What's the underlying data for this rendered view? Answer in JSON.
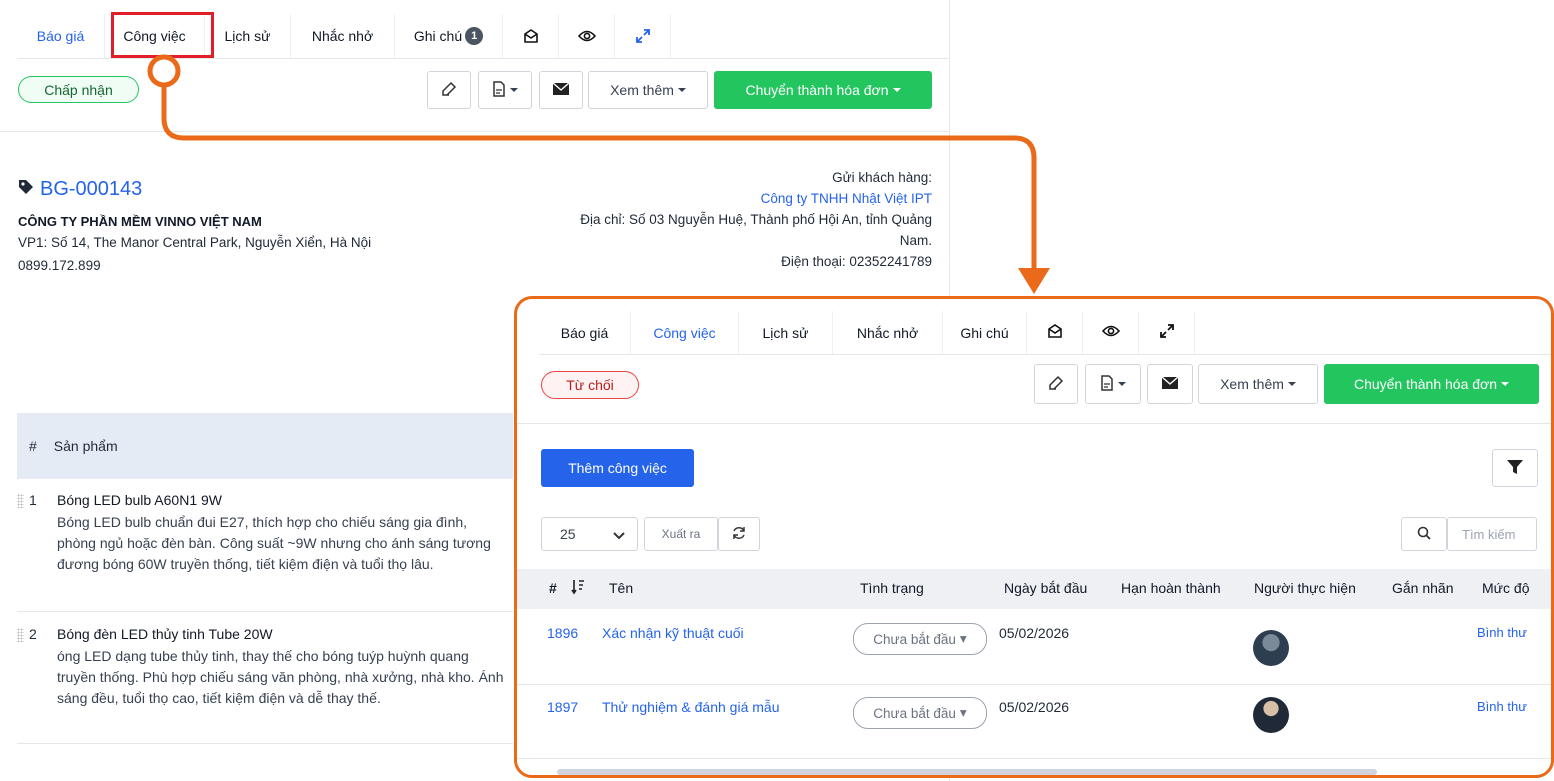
{
  "main": {
    "tabs": [
      {
        "label": "Báo giá",
        "state": "link"
      },
      {
        "label": "Công việc",
        "state": "highlighted"
      },
      {
        "label": "Lịch sử"
      },
      {
        "label": "Nhắc nhở"
      },
      {
        "label": "Ghi chú",
        "badge": "1"
      }
    ],
    "status_pill": "Chấp nhận",
    "toolbar": {
      "more_label": "Xem thêm",
      "convert_label": "Chuyển thành hóa đơn"
    },
    "quote_id": "BG-000143",
    "company_name": "CÔNG TY PHẦN MỀM VINNO VIỆT NAM",
    "company_address": "VP1: Số 14, The Manor Central Park, Nguyễn Xiển, Hà Nội",
    "company_phone": "0899.172.899",
    "send_to_label": "Gửi khách hàng:",
    "customer_name": "Công ty TNHH Nhật Việt IPT",
    "customer_address_1": "Địa chỉ: Số 03 Nguyễn Huệ, Thành phố Hội An, tỉnh Quảng",
    "customer_address_2": "Nam.",
    "customer_phone": "Điện thoại: 02352241789",
    "products_header": {
      "hash": "#",
      "product": "Sản phẩm"
    },
    "products": [
      {
        "num": "1",
        "title": "Bóng LED bulb A60N1 9W",
        "desc": "Bóng LED bulb chuẩn đui E27, thích hợp cho chiếu sáng gia đình, phòng ngủ hoặc đèn bàn. Công suất ~9W nhưng cho ánh sáng tương đương bóng 60W truyền thống, tiết kiệm điện và tuổi thọ lâu."
      },
      {
        "num": "2",
        "title": "Bóng đèn LED thủy tinh Tube 20W",
        "desc": "óng LED dạng tube thủy tinh, thay thế cho bóng tuýp huỳnh quang truyền thống. Phù hợp chiếu sáng văn phòng, nhà xưởng, nhà kho. Ánh sáng đều, tuổi thọ cao, tiết kiệm điện và dễ thay thế."
      }
    ]
  },
  "popup": {
    "tabs": [
      "Báo giá",
      "Công việc",
      "Lịch sử",
      "Nhắc nhở",
      "Ghi chú"
    ],
    "status_pill": "Từ chối",
    "more_label": "Xem thêm",
    "convert_label": "Chuyển thành hóa đơn",
    "add_task_label": "Thêm công việc",
    "page_size": "25",
    "export_label": "Xuất ra",
    "search_placeholder": "Tìm kiếm",
    "columns": [
      "#",
      "Tên",
      "Tình trạng",
      "Ngày bắt đầu",
      "Hạn hoàn thành",
      "Người thực hiện",
      "Gắn nhãn",
      "Mức độ"
    ],
    "rows": [
      {
        "id": "1896",
        "name": "Xác nhận kỹ thuật cuối",
        "status": "Chưa bắt đầu",
        "start": "05/02/2026",
        "priority": "Bình thư"
      },
      {
        "id": "1897",
        "name": "Thử nghiệm & đánh giá mẫu",
        "status": "Chưa bắt đầu",
        "start": "05/02/2026",
        "priority": "Bình thư"
      }
    ]
  },
  "colors": {
    "accent": "#2563eb",
    "green": "#22c55e",
    "callout": "#ea6a1a",
    "highlight": "#e11d2a"
  }
}
